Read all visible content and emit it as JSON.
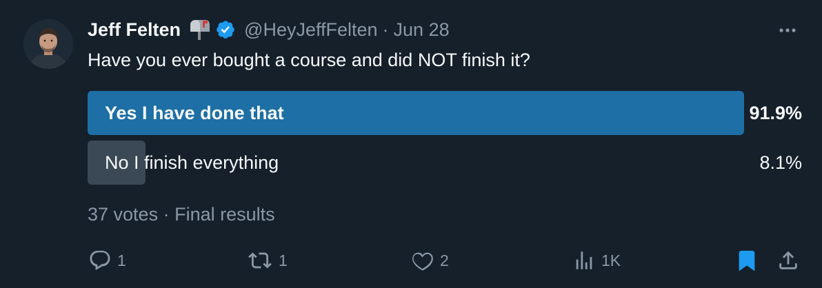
{
  "author": {
    "display_name": "Jeff Felten",
    "handle": "@HeyJeffFelten",
    "separator": "·",
    "date": "Jun 28",
    "badge_icon": "mailbox-emoji-icon",
    "verified_icon": "verified-badge-icon",
    "verified_color": "#1d9bf0"
  },
  "tweet": {
    "text": "Have you ever bought a course and did NOT finish it?"
  },
  "poll": {
    "options": [
      {
        "label": "Yes I have done that",
        "percent_text": "91.9%",
        "percent": 91.9,
        "winner": true,
        "bar_color": "#1d6fa5"
      },
      {
        "label": "No I finish everything",
        "percent_text": "8.1%",
        "percent": 8.1,
        "winner": false,
        "bar_color": "#3b4956"
      }
    ],
    "votes": "37 votes",
    "separator": "·",
    "status": "Final results"
  },
  "actions": {
    "reply": {
      "icon": "reply-icon",
      "count": "1"
    },
    "retweet": {
      "icon": "retweet-icon",
      "count": "1"
    },
    "like": {
      "icon": "heart-icon",
      "count": "2"
    },
    "views": {
      "icon": "views-chart-icon",
      "count": "1K"
    },
    "bookmark": {
      "icon": "bookmark-icon",
      "active": true,
      "color": "#1d9bf0"
    },
    "share": {
      "icon": "share-icon"
    }
  },
  "more_icon": "more-options-icon"
}
